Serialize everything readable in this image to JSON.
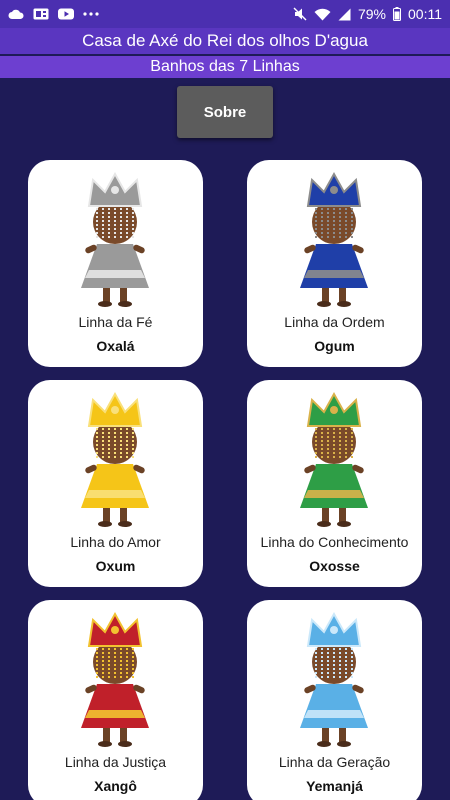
{
  "status_bar": {
    "icons_left": [
      "cloud-icon",
      "sim-card-icon",
      "youtube-icon",
      "more-dots-icon"
    ],
    "icons_right": [
      "mute-icon",
      "wifi-icon",
      "signal-icon"
    ],
    "battery": "79%",
    "time": "00:11"
  },
  "header": {
    "title": "Casa de Axé do Rei dos olhos D'agua",
    "subtitle": "Banhos das 7 Linhas"
  },
  "sobre_button": {
    "label": "Sobre"
  },
  "cards": [
    {
      "line": "Linha da Fé",
      "name": "Oxalá",
      "theme": "#9a9a9a",
      "accent": "#e6e6e6"
    },
    {
      "line": "Linha da Ordem",
      "name": "Ogum",
      "theme": "#1f3fa8",
      "accent": "#8c8c8c"
    },
    {
      "line": "Linha do Amor",
      "name": "Oxum",
      "theme": "#f5c518",
      "accent": "#f9e07a"
    },
    {
      "line": "Linha do Conhecimento",
      "name": "Oxosse",
      "theme": "#2e9e46",
      "accent": "#d9b24a"
    },
    {
      "line": "Linha da Justiça",
      "name": "Xangô",
      "theme": "#c0202a",
      "accent": "#f2c230"
    },
    {
      "line": "Linha da Geração",
      "name": "Yemanjá",
      "theme": "#5ab0e6",
      "accent": "#cbe8fa"
    }
  ],
  "colors": {
    "background": "#1e1b57",
    "status_bar": "#4b2fb0",
    "title_bar": "#5a36c0",
    "subtitle_bar": "#6d3fd0",
    "button": "#5c5c5c"
  }
}
